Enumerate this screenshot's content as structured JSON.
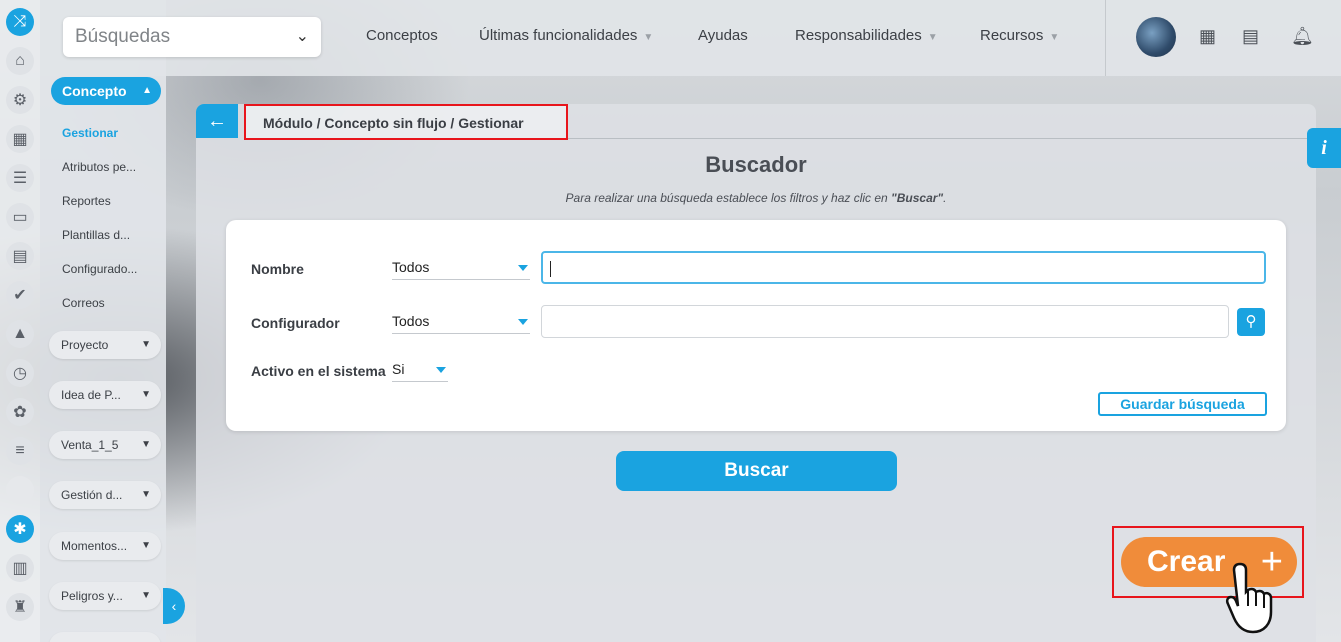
{
  "topbar": {
    "search_placeholder": "Búsquedas",
    "nav": [
      {
        "label": "Conceptos",
        "dropdown": false
      },
      {
        "label": "Últimas funcionalidades",
        "dropdown": true
      },
      {
        "label": "Ayudas",
        "dropdown": false
      },
      {
        "label": "Responsabilidades",
        "dropdown": true
      },
      {
        "label": "Recursos",
        "dropdown": true
      }
    ],
    "icons": [
      "calendar-icon",
      "map-icon",
      "bell-icon"
    ]
  },
  "rail": {
    "icons": [
      "shuffle-icon",
      "home-icon",
      "gear-icon",
      "map-icon",
      "sliders-icon",
      "monitor-icon",
      "clipboard-icon",
      "check-circle-icon",
      "warning-icon",
      "clock-icon",
      "sprout-icon",
      "list-icon",
      "blank",
      "bug-icon",
      "bar-chart-icon",
      "chess-icon"
    ]
  },
  "sidebar": {
    "section_label": "Concepto",
    "links": [
      "Gestionar",
      "Atributos pe...",
      "Reportes",
      "Plantillas d...",
      "Configurado...",
      "Correos"
    ],
    "groups": [
      "Proyecto",
      "Idea de P...",
      "Venta_1_5",
      "Gestión d...",
      "Momentos...",
      "Peligros y..."
    ]
  },
  "breadcrumb": "Módulo / Concepto sin flujo / Gestionar",
  "finder": {
    "title": "Buscador",
    "hint_prefix": "Para realizar una búsqueda establece los filtros y haz clic en ",
    "hint_bold": "\"Buscar\"",
    "hint_suffix": ".",
    "fields": {
      "nombre_label": "Nombre",
      "nombre_select": "Todos",
      "nombre_value": "",
      "configurador_label": "Configurador",
      "configurador_select": "Todos",
      "configurador_value": "",
      "activo_label": "Activo en el sistema",
      "activo_select": "Si"
    },
    "save_search_label": "Guardar búsqueda",
    "search_button_label": "Buscar"
  },
  "info_label": "i",
  "create_button_label": "Crear",
  "create_button_plus": "+",
  "colors": {
    "accent": "#1aa3e0",
    "create": "#f08c3a",
    "highlight": "#e8151c"
  }
}
